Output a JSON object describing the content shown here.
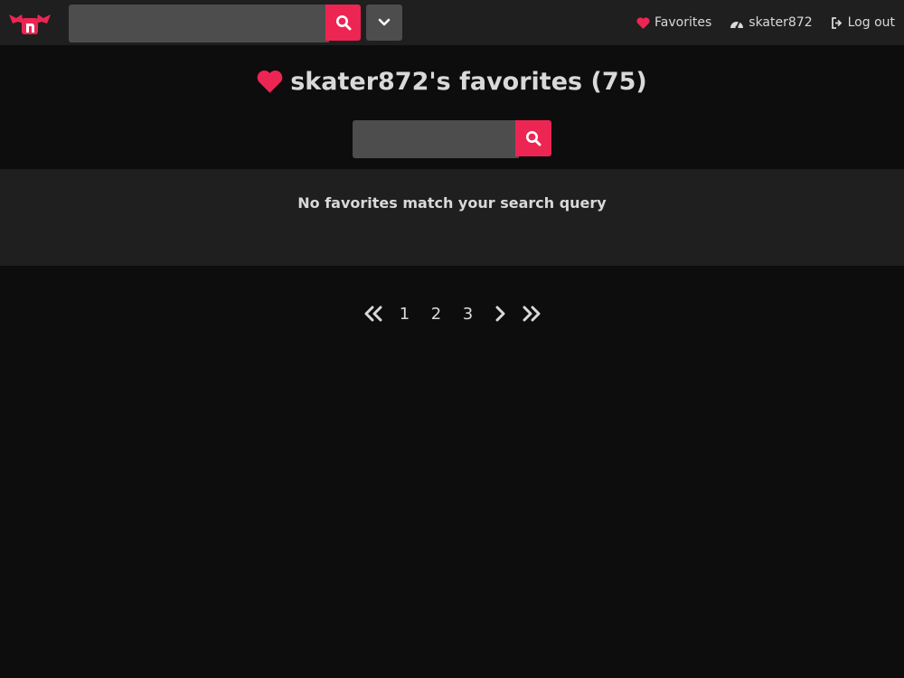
{
  "colors": {
    "accent": "#ed2553",
    "navbar": "#1f1f1f",
    "background": "#0d0d0d",
    "input": "#4d4d4d",
    "text": "#d9d9d9"
  },
  "navbar": {
    "logo_icon": "bat-n-logo",
    "search": {
      "value": "",
      "placeholder": ""
    },
    "links": [
      {
        "label": "Favorites",
        "icon": "heart-icon"
      },
      {
        "label": "skater872",
        "icon": "dashboard-icon"
      },
      {
        "label": "Log out",
        "icon": "sign-out-icon"
      }
    ]
  },
  "page": {
    "title_icon": "heart-icon",
    "title": "skater872's favorites",
    "count": "(75)",
    "search": {
      "value": "",
      "placeholder": ""
    }
  },
  "results": {
    "message": "No favorites match your search query"
  },
  "pagination": {
    "first": "first-page-icon",
    "pages": [
      "1",
      "2",
      "3"
    ],
    "next": "next-page-icon",
    "last": "last-page-icon"
  }
}
